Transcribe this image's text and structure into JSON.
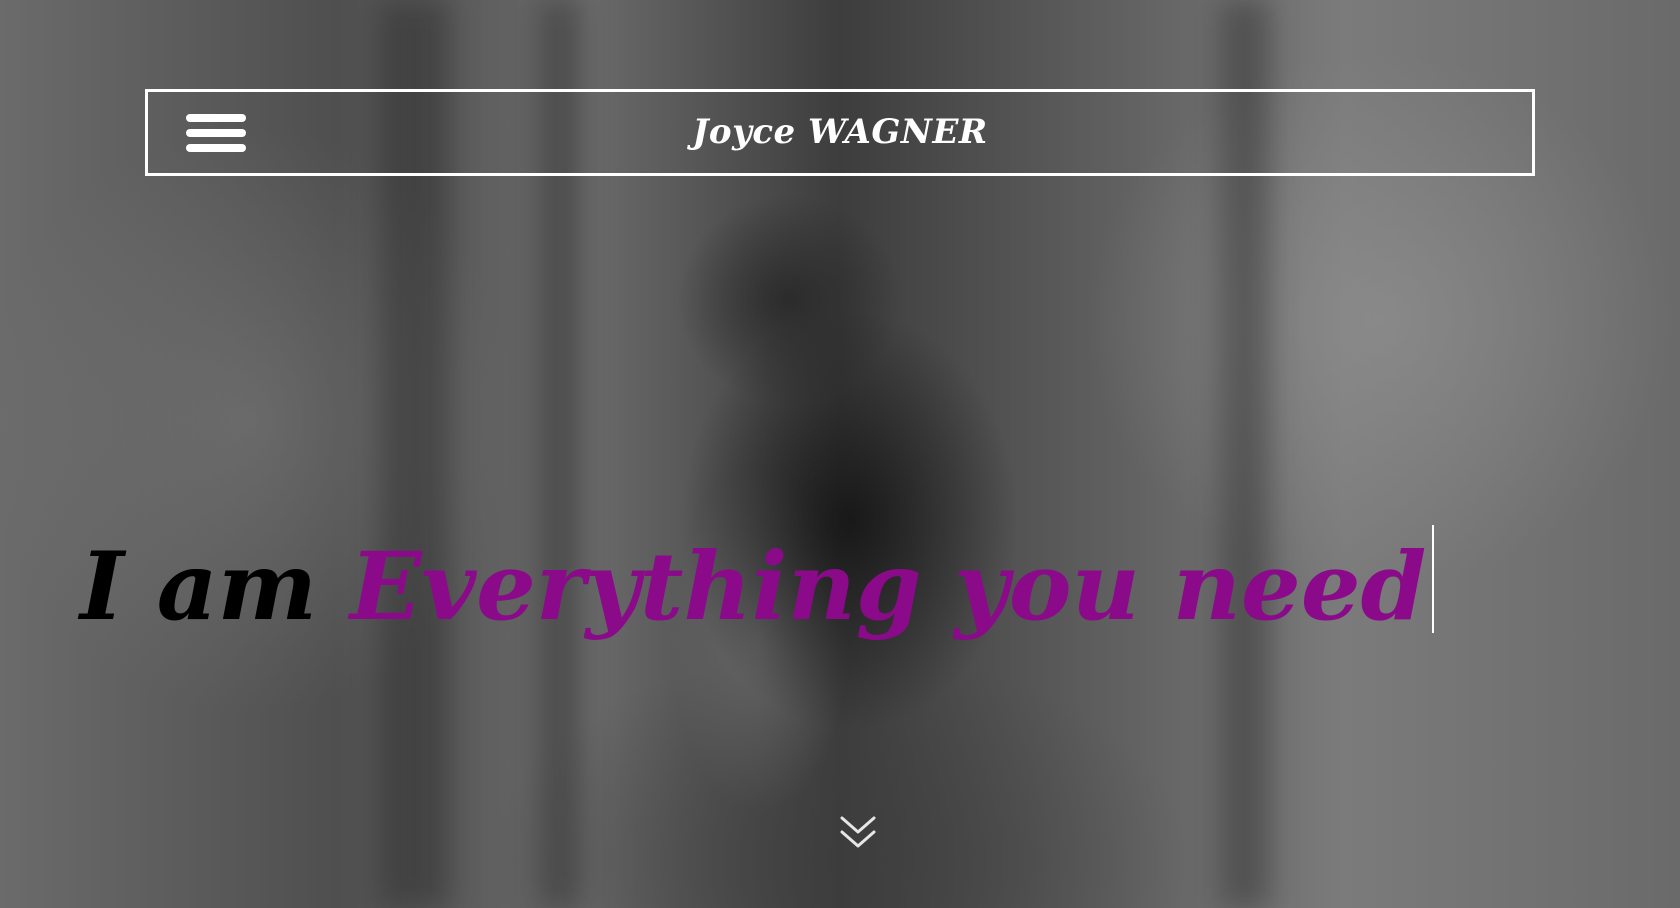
{
  "header": {
    "site_title": "Joyce WAGNER",
    "menu_icon": "hamburger-menu-icon"
  },
  "hero": {
    "headline_prefix": "I am",
    "headline_typed": "Everything you need",
    "scroll_icon": "double-chevron-down-icon"
  },
  "colors": {
    "header_border": "#ffffff",
    "title_text": "#ffffff",
    "headline_prefix": "#000000",
    "headline_typed": "#8a0a8a",
    "caret": "#ffffff"
  }
}
